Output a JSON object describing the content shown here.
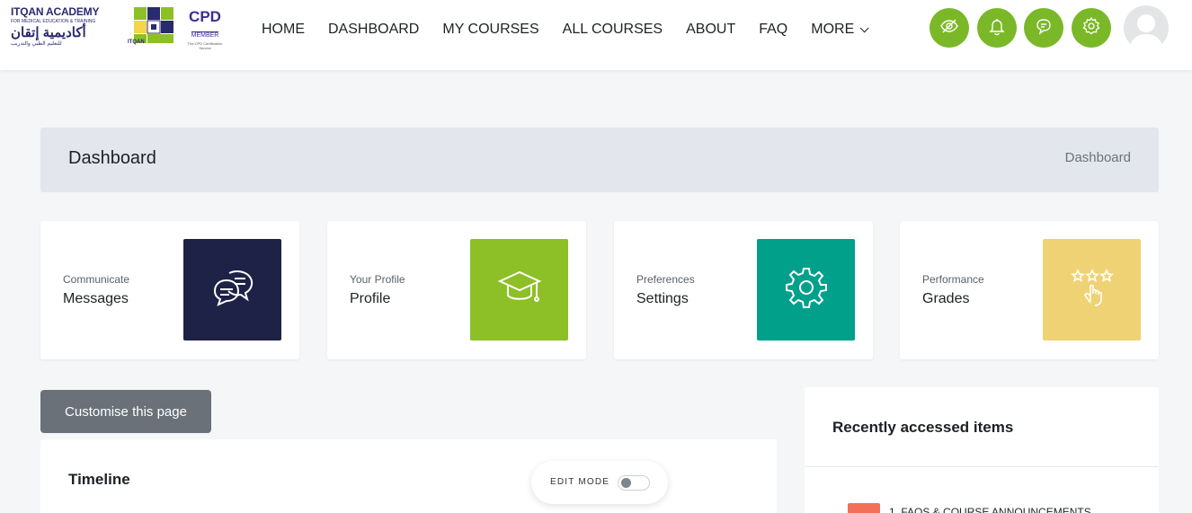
{
  "brand": {
    "name_en": "ITQAN ACADEMY",
    "tagline_en": "FOR MEDICAL EDUCATION & TRAINING",
    "name_ar": "أكاديمية إتقان",
    "tagline_ar": "للتعليم الطبي والتدريب",
    "mark_label": "ITQAN",
    "cpd_title": "CPD",
    "cpd_member": "MEMBER",
    "cpd_note": "The CPD Certification Service"
  },
  "nav": {
    "items": [
      "HOME",
      "DASHBOARD",
      "MY COURSES",
      "ALL COURSES",
      "ABOUT",
      "FAQ"
    ],
    "more_label": "MORE"
  },
  "header_icons": [
    "eye-slash-icon",
    "bell-icon",
    "chat-icon",
    "gear-icon"
  ],
  "colors": {
    "accent_green": "#7ab828",
    "messages_tile": "#1e2247",
    "profile_tile": "#8dbf27",
    "settings_tile": "#00a08a",
    "grades_tile": "#efd273",
    "recent_chip": "#f07157"
  },
  "page": {
    "title": "Dashboard",
    "breadcrumb": "Dashboard"
  },
  "cards": [
    {
      "caption": "Communicate",
      "label": "Messages",
      "icon": "messages-icon"
    },
    {
      "caption": "Your Profile",
      "label": "Profile",
      "icon": "graduation-cap-icon"
    },
    {
      "caption": "Preferences",
      "label": "Settings",
      "icon": "gear-icon"
    },
    {
      "caption": "Performance",
      "label": "Grades",
      "icon": "stars-hand-icon"
    }
  ],
  "customise_label": "Customise this page",
  "timeline": {
    "title": "Timeline"
  },
  "edit_mode": {
    "label": "EDIT MODE",
    "enabled": false
  },
  "recent": {
    "title": "Recently accessed items",
    "items": [
      "1. FAQS & COURSE ANNOUNCEMENTS"
    ]
  }
}
